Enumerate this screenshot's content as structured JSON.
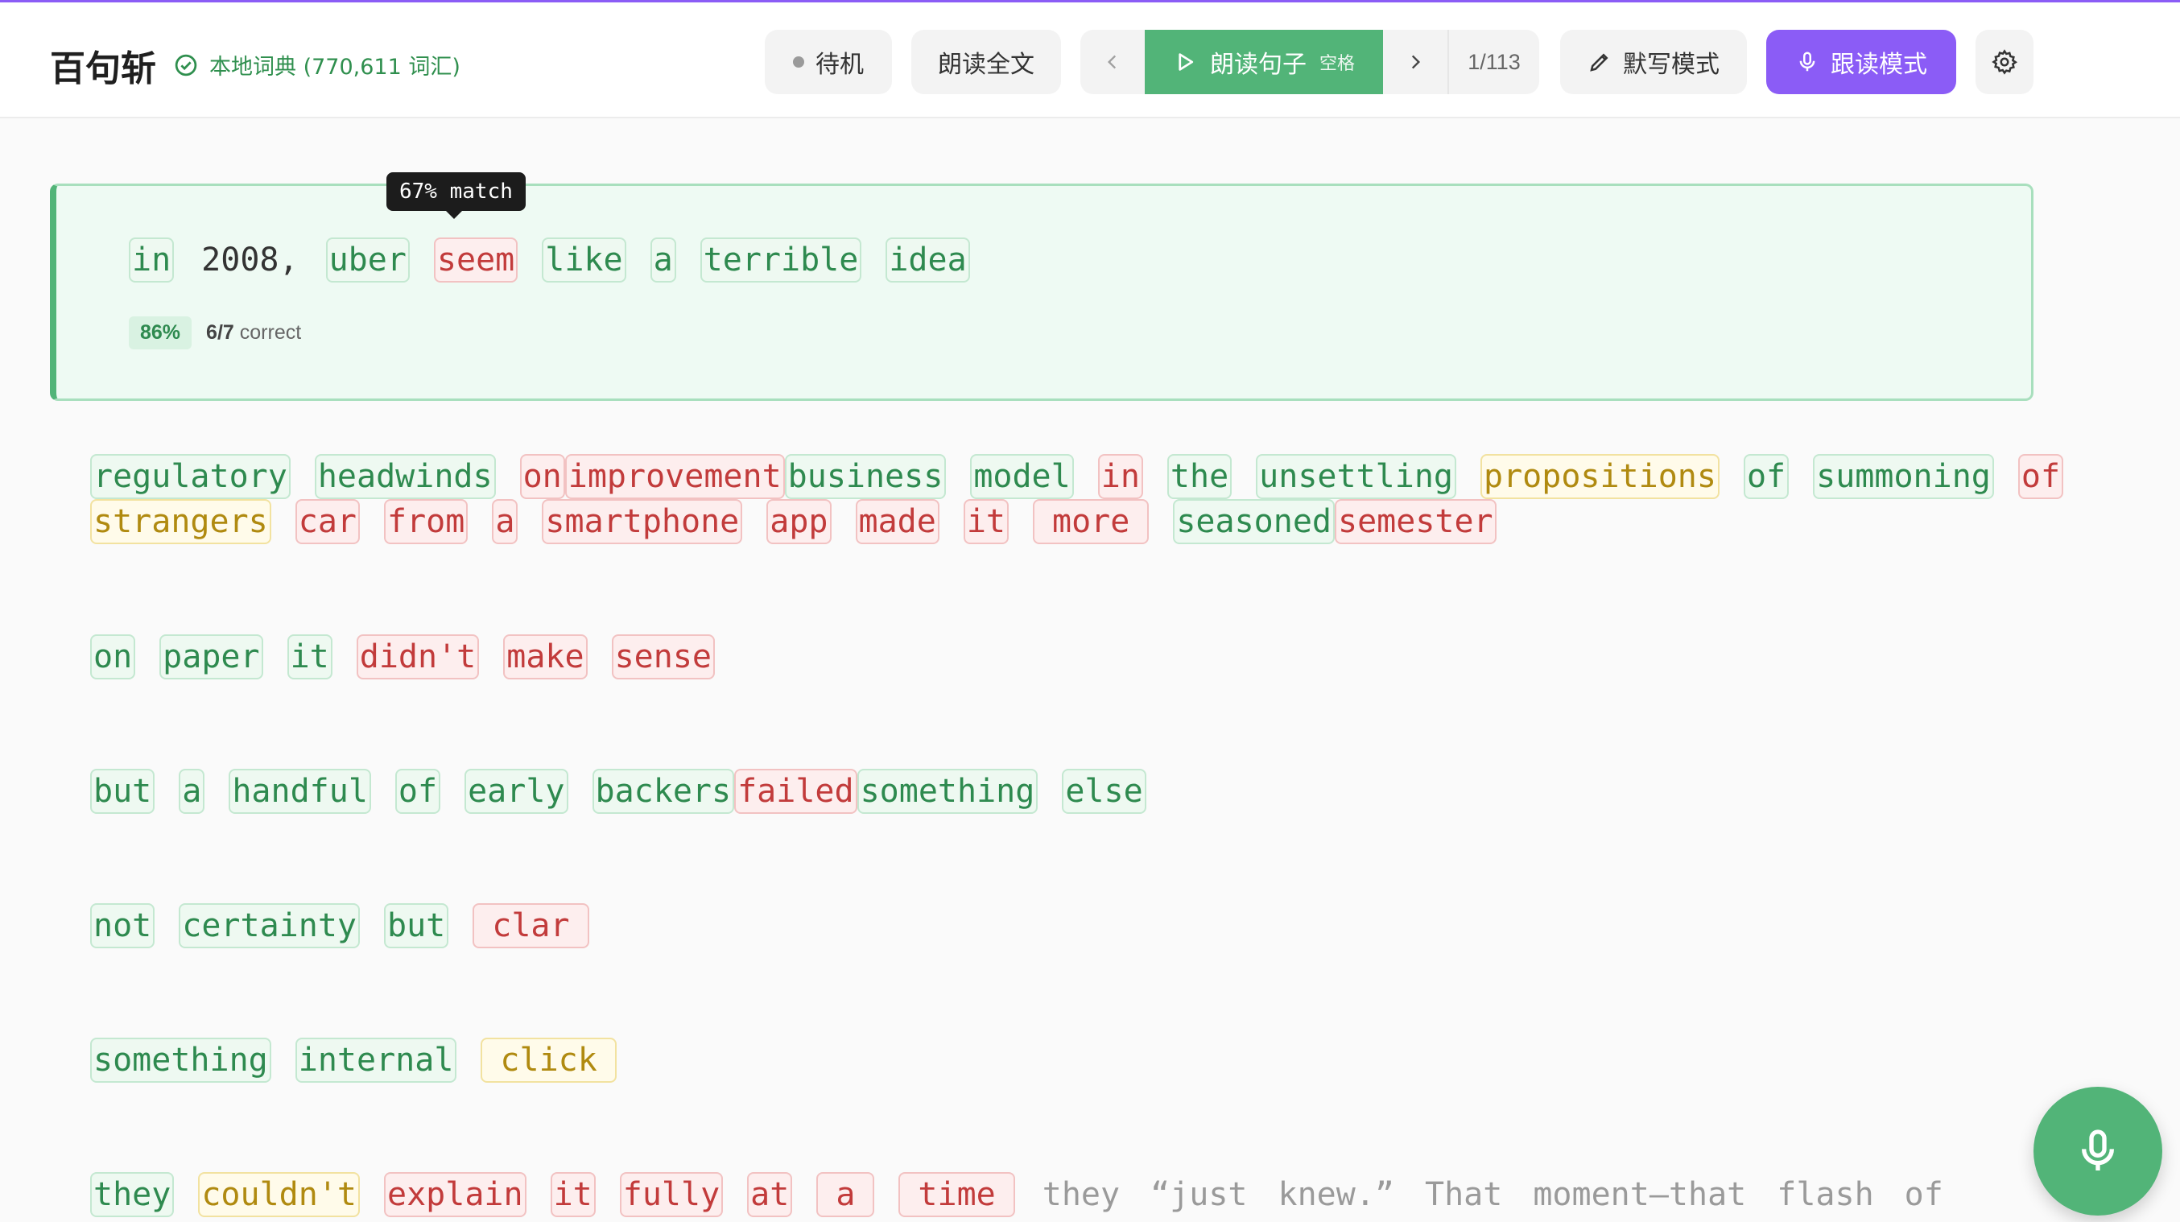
{
  "header": {
    "app_title": "百句斩",
    "dict_status": "本地词典 (770,611 词汇)",
    "standby_label": "待机",
    "read_all_label": "朗读全文",
    "play_sentence_label": "朗读句子",
    "play_sentence_hint": "空格",
    "sentence_counter": "1/113",
    "dictation_label": "默写模式",
    "shadowing_label": "跟读模式"
  },
  "current_sentence": {
    "tooltip": "67% match",
    "words": [
      {
        "text": "in",
        "state": "c"
      },
      {
        "text": "2008,",
        "state": "plain"
      },
      {
        "text": "uber",
        "state": "c"
      },
      {
        "text": "seem",
        "state": "e"
      },
      {
        "text": "like",
        "state": "c"
      },
      {
        "text": "a",
        "state": "c"
      },
      {
        "text": "terrible",
        "state": "c"
      },
      {
        "text": "idea",
        "state": "c"
      }
    ],
    "score_percent": "86%",
    "score_count": "6/7",
    "score_suffix": "correct"
  },
  "lines": [
    {
      "words": [
        {
          "t": "regulatory",
          "s": "c"
        },
        {
          "t": "headwinds",
          "s": "c"
        },
        {
          "t": "on",
          "s": "e",
          "tight": true
        },
        {
          "t": "improvement",
          "s": "e",
          "tight": true
        },
        {
          "t": "business",
          "s": "c"
        },
        {
          "t": "model",
          "s": "c"
        },
        {
          "t": "in",
          "s": "e"
        },
        {
          "t": "the",
          "s": "c"
        },
        {
          "t": "unsettling",
          "s": "c"
        },
        {
          "t": "propositions",
          "s": "p"
        },
        {
          "t": "of",
          "s": "c"
        },
        {
          "t": "summoning",
          "s": "c"
        },
        {
          "t": "of",
          "s": "e"
        }
      ]
    },
    {
      "words": [
        {
          "t": "strangers",
          "s": "p"
        },
        {
          "t": "car",
          "s": "e"
        },
        {
          "t": "from",
          "s": "e"
        },
        {
          "t": "a",
          "s": "e"
        },
        {
          "t": "smartphone",
          "s": "e"
        },
        {
          "t": "app",
          "s": "e"
        },
        {
          "t": "made",
          "s": "e"
        },
        {
          "t": "it",
          "s": "e"
        },
        {
          "t": "more",
          "s": "e",
          "pad": true
        },
        {
          "t": "seasoned",
          "s": "c",
          "tight": true
        },
        {
          "t": "semester",
          "s": "e"
        }
      ]
    },
    {
      "words": [
        {
          "t": "on",
          "s": "c"
        },
        {
          "t": "paper",
          "s": "c"
        },
        {
          "t": "it",
          "s": "c"
        },
        {
          "t": "didn't",
          "s": "e"
        },
        {
          "t": "make",
          "s": "e"
        },
        {
          "t": "sense",
          "s": "e"
        }
      ]
    },
    {
      "words": [
        {
          "t": "but",
          "s": "c"
        },
        {
          "t": "a",
          "s": "c"
        },
        {
          "t": "handful",
          "s": "c"
        },
        {
          "t": "of",
          "s": "c"
        },
        {
          "t": "early",
          "s": "c"
        },
        {
          "t": "backers",
          "s": "c",
          "tight": true
        },
        {
          "t": "failed",
          "s": "e",
          "tight": true
        },
        {
          "t": "something",
          "s": "c"
        },
        {
          "t": "else",
          "s": "c"
        }
      ]
    },
    {
      "words": [
        {
          "t": "not",
          "s": "c"
        },
        {
          "t": "certainty",
          "s": "c"
        },
        {
          "t": "but",
          "s": "c"
        },
        {
          "t": "clar",
          "s": "e",
          "pad": true
        }
      ]
    },
    {
      "words": [
        {
          "t": "something",
          "s": "c"
        },
        {
          "t": "internal",
          "s": "c"
        },
        {
          "t": "click",
          "s": "p",
          "pad": true
        }
      ]
    },
    {
      "words": [
        {
          "t": "they",
          "s": "c"
        },
        {
          "t": "couldn't",
          "s": "p"
        },
        {
          "t": "explain",
          "s": "e"
        },
        {
          "t": "it",
          "s": "e"
        },
        {
          "t": "fully",
          "s": "e"
        },
        {
          "t": "at",
          "s": "e"
        },
        {
          "t": "a",
          "s": "e",
          "pad": true
        },
        {
          "t": "time",
          "s": "e",
          "pad": true
        },
        {
          "t": "they",
          "s": "u"
        },
        {
          "t": "“just",
          "s": "u"
        },
        {
          "t": "knew.”",
          "s": "u"
        },
        {
          "t": "That",
          "s": "u"
        },
        {
          "t": "moment—that",
          "s": "u"
        },
        {
          "t": "flash",
          "s": "u"
        },
        {
          "t": "of",
          "s": "u"
        }
      ]
    }
  ]
}
